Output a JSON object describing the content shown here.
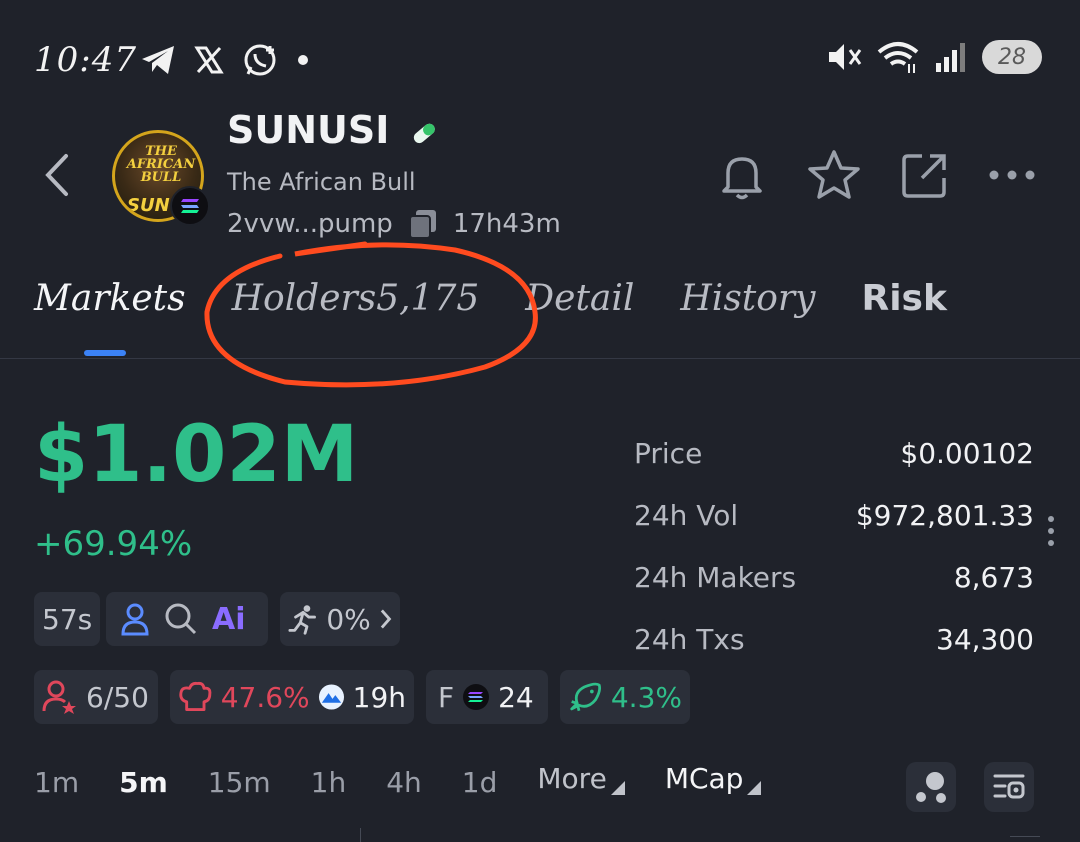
{
  "status_bar": {
    "time": "10:47",
    "battery": "28",
    "left_icons": [
      "telegram-icon",
      "x-icon",
      "whatsapp-icon",
      "dot-icon"
    ],
    "right_icons": [
      "mute-icon",
      "wifi-icon",
      "signal-icon",
      "battery-icon"
    ]
  },
  "token": {
    "name": "SUNUSI",
    "subtitle": "The African Bull",
    "address": "2vvw...pump",
    "age": "17h43m",
    "avatar_text_top": "THE AFRICAN BULL",
    "avatar_text_bottom": "SUNU"
  },
  "tabs": [
    {
      "label": "Markets",
      "active": true
    },
    {
      "label": "Holders5,175",
      "active": false
    },
    {
      "label": "Detail",
      "active": false
    },
    {
      "label": "History",
      "active": false
    },
    {
      "label": "Risk",
      "active": false
    }
  ],
  "market": {
    "market_cap": "$1.02M",
    "change": "+69.94%"
  },
  "stats": [
    {
      "label": "Price",
      "value": "$0.00102"
    },
    {
      "label": "24h Vol",
      "value": "$972,801.33"
    },
    {
      "label": "24h Makers",
      "value": "8,673"
    },
    {
      "label": "24h Txs",
      "value": "34,300"
    }
  ],
  "chips_row1": {
    "age": "57s",
    "ai": "Ai",
    "runner": "0%"
  },
  "chips_row2": {
    "followers": "6/50",
    "chef": "47.6%",
    "mountain": "19h",
    "f_label": "F",
    "sol": "24",
    "whale": "4.3%"
  },
  "timeframes": [
    "1m",
    "5m",
    "15m",
    "1h",
    "4h",
    "1d"
  ],
  "timeframe_active": "5m",
  "more_label": "More",
  "mcap_label": "MCap",
  "colors": {
    "background": "#1f222a",
    "green": "#2fbf8a",
    "red": "#e0475b",
    "accent": "#3b82f6",
    "annotation": "#ff4b1f"
  }
}
